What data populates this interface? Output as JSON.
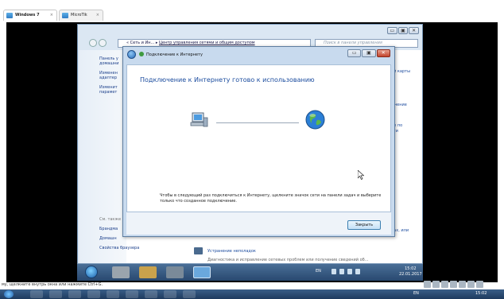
{
  "host": {
    "tabs": [
      {
        "label": "Windows 7",
        "close": "×"
      },
      {
        "label": "MicroTik",
        "close": "×"
      }
    ],
    "status_text": "му, щелкните внутрь окна или нажмите Ctrl+G.",
    "taskbar": {
      "lang": "EN",
      "time": "15:02"
    }
  },
  "control_panel": {
    "window_buttons": [
      "▭",
      "▣",
      "✕"
    ],
    "address_parts": [
      "« Сеть и Ин...",
      "▸",
      "Центр управления сетями и общим доступом"
    ],
    "search_placeholder": "Поиск в панели управления",
    "left_items": [
      "Панель у",
      "домашни",
      "Изменен",
      "адаптер",
      "Изменит",
      "парамет"
    ],
    "left_bottom": [
      "См. также",
      "Брандма",
      "Домашн",
      "Свойства браузера"
    ],
    "right_items": [
      "ой карты",
      "ючение",
      "ие по",
      "сти",
      "рах, или"
    ],
    "troubleshoot_link": "Устранение неполадок",
    "bottom_faded": "Диагностика и исправление сетевых проблем или получение сведений об..."
  },
  "wizard": {
    "title": "Подключение к Интернету",
    "window_buttons": [
      "▭",
      "▣",
      "✕"
    ],
    "heading": "Подключение к Интернету готово к использованию",
    "note": "Чтобы в следующий раз подключиться к Интернету, щелкните значок сети на панели задач и выберите только что созданное подключение.",
    "close_button": "Закрыть"
  },
  "guest_taskbar": {
    "lang": "EN",
    "time": "15:02",
    "date": "22.01.2017"
  },
  "colors": {
    "accent": "#1a4b9e",
    "desktop": "#9bb7d3",
    "taskbar": "#28486f"
  }
}
